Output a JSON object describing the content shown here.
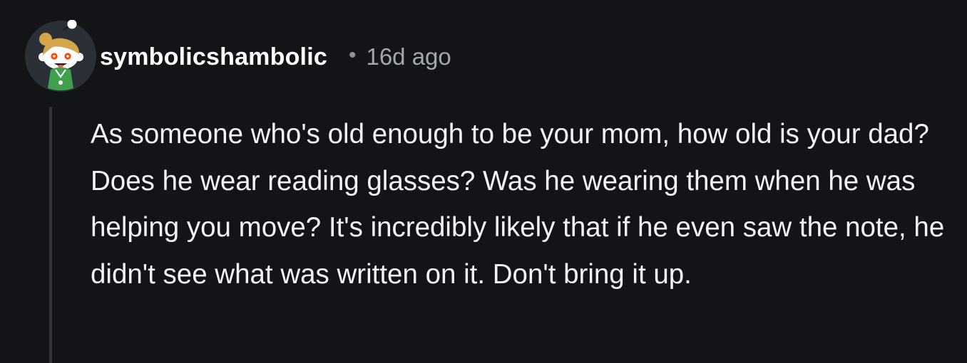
{
  "comment": {
    "author": "symbolicshambolic",
    "separator": "•",
    "timestamp": "16d ago",
    "avatar_icon": "snoo-avatar-icon",
    "body": "As someone who's old enough to be your mom, how old is your dad? Does he wear reading glasses? Was he wearing them when he was helping you move? It's incredibly likely that if he even saw the note, he didn't see what was written on it. Don't bring it up."
  },
  "colors": {
    "background": "#121418",
    "username": "#ffffff",
    "meta": "#a2a7ad",
    "body_text": "#f2f3f5",
    "thread_line": "#30343a",
    "avatar_background": "#2b2f36",
    "avatar_hair": "#d4a64a",
    "avatar_shirt": "#3fa04f"
  }
}
